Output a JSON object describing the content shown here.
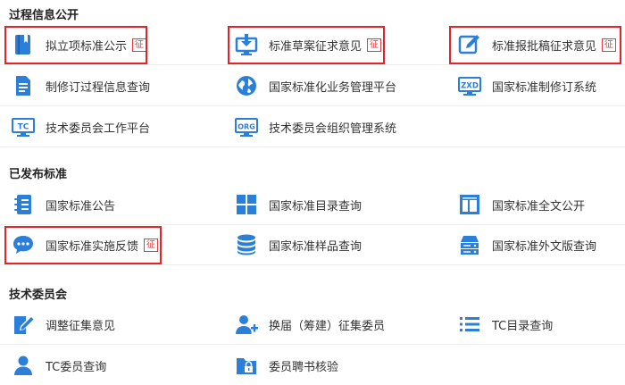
{
  "sections": {
    "process_title": "过程信息公开",
    "published_title": "已发布标准",
    "committee_title": "技术委员会"
  },
  "process": {
    "proposed_publicity": "拟立项标准公示",
    "draft_comments": "标准草案征求意见",
    "approval_comments": "标准报批稿征求意见",
    "revision_query": "制修订过程信息查询",
    "business_platform": "国家标准化业务管理平台",
    "revision_system": "国家标准制修订系统",
    "tc_platform": "技术委员会工作平台",
    "tc_org_system": "技术委员会组织管理系统"
  },
  "published": {
    "announcement": "国家标准公告",
    "catalog_query": "国家标准目录查询",
    "fulltext": "国家标准全文公开",
    "feedback": "国家标准实施反馈",
    "sample_query": "国家标准样品查询",
    "foreign_query": "国家标准外文版查询"
  },
  "committee": {
    "adjust_comments": "调整征集意见",
    "reelection": "换届（筹建）征集委员",
    "tc_catalog": "TC目录查询",
    "tc_member_query": "TC委员查询",
    "member_verify": "委员聘书核验"
  },
  "badge_label": "征",
  "icon_text": {
    "zxd": "ZXD",
    "tc": "TC",
    "org": "ORG"
  },
  "colors": {
    "icon_blue": "#2b7fd8",
    "highlight_red": "#e0242a",
    "badge_red": "#e23b3b"
  }
}
